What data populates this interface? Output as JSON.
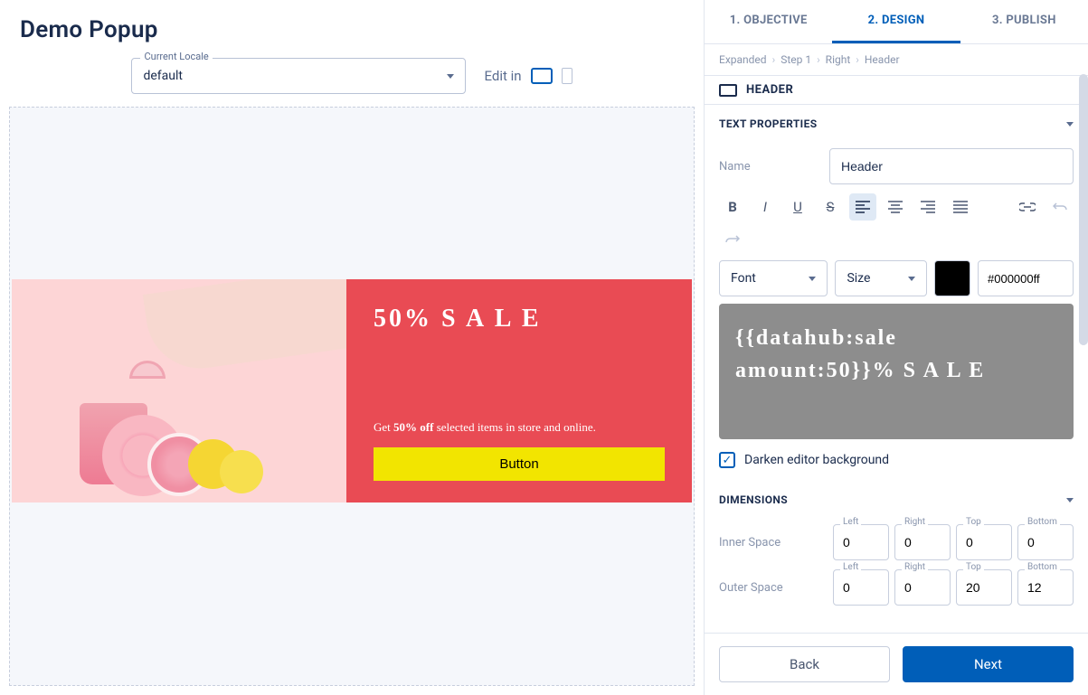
{
  "title": "Demo Popup",
  "locale": {
    "label": "Current Locale",
    "value": "default"
  },
  "editIn": "Edit in",
  "tabs": {
    "t1": "1. OBJECTIVE",
    "t2": "2. DESIGN",
    "t3": "3. PUBLISH"
  },
  "breadcrumb": {
    "b1": "Expanded",
    "b2": "Step 1",
    "b3": "Right",
    "b4": "Header"
  },
  "headerSection": "HEADER",
  "textProps": {
    "title": "TEXT PROPERTIES",
    "nameLabel": "Name",
    "nameValue": "Header",
    "fontLabel": "Font",
    "sizeLabel": "Size",
    "colorHex": "#000000ff",
    "editorContent": "{{datahub:sale amount:50}}% S A L E",
    "darkenLabel": "Darken editor background"
  },
  "dimensions": {
    "title": "DIMENSIONS",
    "innerLabel": "Inner Space",
    "outerLabel": "Outer Space",
    "left": "Left",
    "right": "Right",
    "top": "Top",
    "bottom": "Bottom",
    "inner": {
      "left": "0",
      "right": "0",
      "top": "0",
      "bottom": "0"
    },
    "outer": {
      "left": "0",
      "right": "0",
      "top": "20",
      "bottom": "12"
    }
  },
  "footer": {
    "back": "Back",
    "next": "Next"
  },
  "preview": {
    "header": "50% S A L E",
    "subPrefix": "Get ",
    "subBold": "50% off",
    "subSuffix": " selected items in store and online.",
    "button": "Button"
  }
}
